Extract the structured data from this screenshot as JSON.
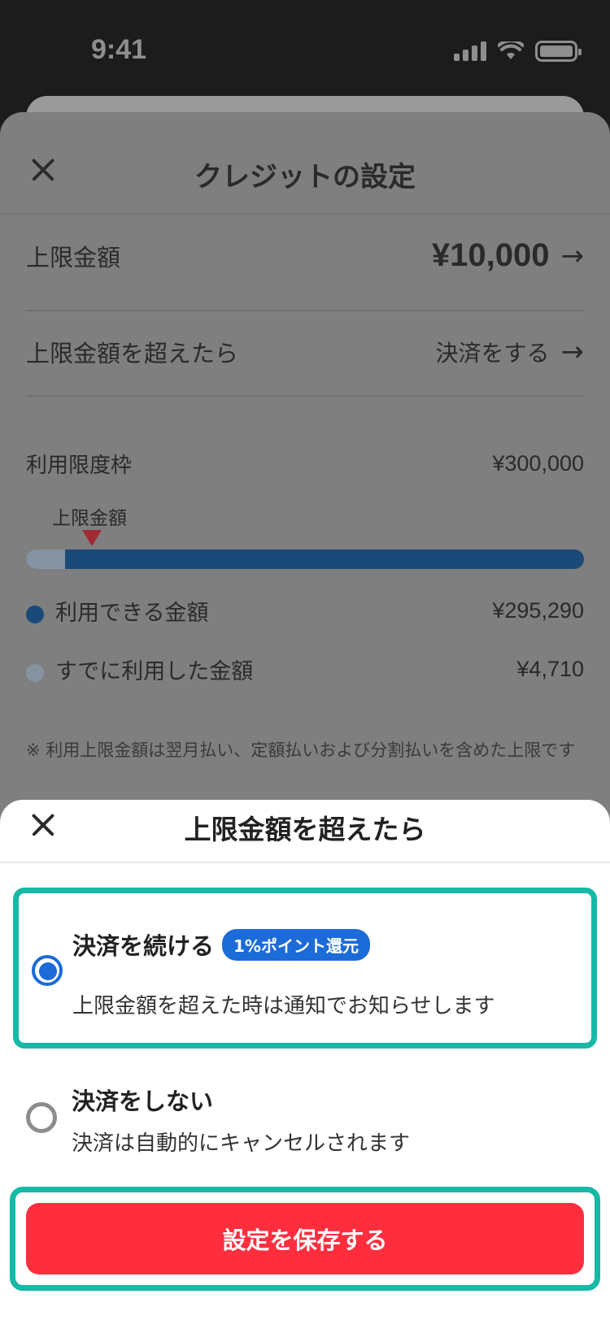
{
  "status_bar": {
    "time": "9:41"
  },
  "background_sheet": {
    "title": "クレジットの設定",
    "limit_row": {
      "label": "上限金額",
      "value": "¥10,000",
      "arrow": "→"
    },
    "exceed_row": {
      "label": "上限金額を超えたら",
      "value": "決済をする",
      "arrow": "→"
    },
    "usage_limit": {
      "label": "利用限度枠",
      "value": "¥300,000"
    },
    "gauge": {
      "caption": "上限金額",
      "used_fraction": 0.0157
    },
    "available": {
      "label": "利用できる金額",
      "value": "¥295,290",
      "color": "#1a4a78"
    },
    "used": {
      "label": "すでに利用した金額",
      "value": "¥4,710",
      "color": "#8693a0"
    },
    "note": "※ 利用上限金額は翌月払い、定額払いおよび分割払いを含めた上限です"
  },
  "modal": {
    "title": "上限金額を超えたら",
    "options": [
      {
        "title": "決済を続ける",
        "badge": "1%ポイント還元",
        "description": "上限金額を超えた時は通知でお知らせします",
        "selected": true
      },
      {
        "title": "決済をしない",
        "description": "決済は自動的にキャンセルされます",
        "selected": false
      }
    ],
    "save_label": "設定を保存する"
  },
  "colors": {
    "accent_blue": "#1b6bd8",
    "save_red": "#ff2e3e",
    "highlight_teal": "#16b8a6"
  }
}
